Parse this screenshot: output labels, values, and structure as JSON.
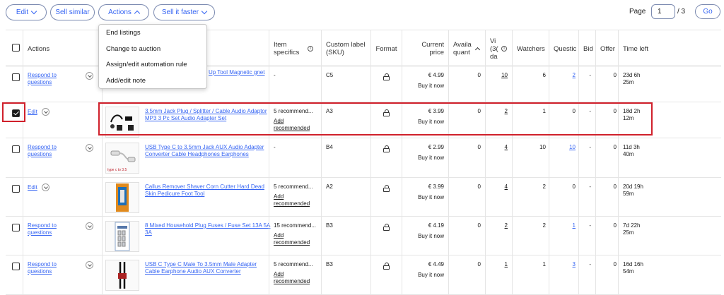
{
  "toolbar": {
    "edit_label": "Edit",
    "sell_similar_label": "Sell similar",
    "actions_label": "Actions",
    "sell_faster_label": "Sell it faster",
    "page_label": "Page",
    "page_value": "1",
    "page_total": "/ 3",
    "go_label": "Go"
  },
  "menu": {
    "items": [
      "End listings",
      "Change to auction",
      "Assign/edit automation rule",
      "Add/edit note"
    ]
  },
  "headers": {
    "actions": "Actions",
    "item_specifics": "Item specifics",
    "custom_label": "Custom label (SKU)",
    "format": "Format",
    "current_price": "Current price",
    "available_quantity": "Availa quant",
    "views": "Vi (3( da",
    "watchers": "Watchers",
    "questions": "Questic",
    "bids": "Bid",
    "offers": "Offer",
    "time_left": "Time left"
  },
  "colors": {
    "link": "#3665f3",
    "highlight": "#d0202b",
    "border": "#7b8ab0"
  },
  "rows": [
    {
      "action": "Respond to questions",
      "title": "Up Tool Magnetic gnet",
      "specifics": "-",
      "add_rec": "",
      "sku": "C5",
      "price": "€ 4.99",
      "format": "Buy it now",
      "qty": "0",
      "views": "10",
      "watchers": "6",
      "questions": "2",
      "bids": "-",
      "offers": "0",
      "time_left": "23d 6h 25m",
      "thumb_icon": "none"
    },
    {
      "action": "Edit",
      "title": "3.5mm Jack Plug / Splitter / Cable Audio Adaptor MP3 3 Pc Set Audio Adapter Set",
      "specifics": "5 recommend...",
      "add_rec": "Add recommended",
      "sku": "A3",
      "price": "€ 3.99",
      "format": "Buy it now",
      "qty": "0",
      "views": "2",
      "watchers": "1",
      "questions": "0",
      "bids": "-",
      "offers": "0",
      "time_left": "18d 2h 12m",
      "thumb_icon": "audio-adapter-set"
    },
    {
      "action": "Respond to questions",
      "title": "USB Type C to 3.5mm Jack AUX Audio Adapter Converter Cable Headphones Earphones",
      "specifics": "-",
      "add_rec": "",
      "sku": "B4",
      "price": "€ 2.99",
      "format": "Buy it now",
      "qty": "0",
      "views": "4",
      "watchers": "10",
      "questions": "10",
      "bids": "-",
      "offers": "0",
      "time_left": "11d 3h 40m",
      "thumb_icon": "usb-c-adapter",
      "thumb_caption": "type c to 3.5"
    },
    {
      "action": "Edit",
      "title": "Callus Remover Shaver Corn Cutter Hard Dead Skin Pedicure Foot Tool",
      "specifics": "5 recommend...",
      "add_rec": "Add recommended",
      "sku": "A2",
      "price": "€ 3.99",
      "format": "Buy it now",
      "qty": "0",
      "views": "4",
      "watchers": "2",
      "questions": "0",
      "bids": "-",
      "offers": "0",
      "time_left": "20d 19h 59m",
      "thumb_icon": "callus-remover"
    },
    {
      "action": "Respond to questions",
      "title": "8 Mixed Household Plug Fuses / Fuse Set 13A 5A 3A",
      "specifics": "15 recommend...",
      "add_rec": "Add recommended",
      "sku": "B3",
      "price": "€ 4.19",
      "format": "Buy it now",
      "qty": "0",
      "views": "2",
      "watchers": "2",
      "questions": "1",
      "bids": "-",
      "offers": "0",
      "time_left": "7d 22h 25m",
      "thumb_icon": "fuse-set"
    },
    {
      "action": "Respond to questions",
      "title": "USB C Type C Male To 3.5mm Male Adapter Cable Earphone Audio AUX Converter",
      "specifics": "5 recommend...",
      "add_rec": "Add recommended",
      "sku": "B3",
      "price": "€ 4.49",
      "format": "Buy it now",
      "qty": "0",
      "views": "1",
      "watchers": "1",
      "questions": "3",
      "bids": "-",
      "offers": "0",
      "time_left": "16d 16h 54m",
      "thumb_icon": "aux-cable"
    }
  ]
}
